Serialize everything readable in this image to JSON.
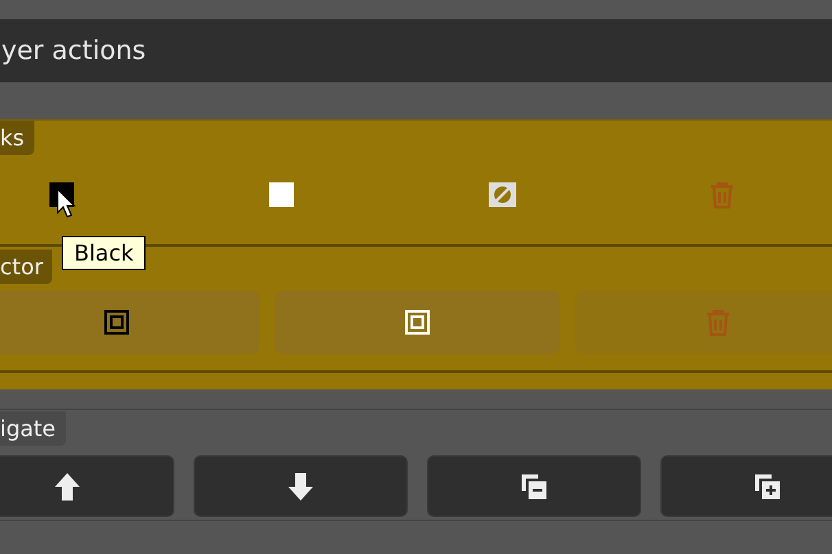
{
  "title": "yer actions",
  "sections": [
    {
      "label": "ks",
      "buttons": [
        {
          "disabled": false
        },
        {
          "disabled": false
        },
        {
          "disabled": false
        },
        {
          "disabled": true
        }
      ]
    },
    {
      "label": "ctor",
      "buttons": [
        {
          "disabled": false
        },
        {
          "disabled": false
        },
        {
          "disabled": true
        }
      ]
    }
  ],
  "tooltip": "Black",
  "navigate": {
    "label": "igate",
    "buttons": [
      {
        "disabled": false
      },
      {
        "disabled": false
      },
      {
        "disabled": false
      },
      {
        "disabled": false
      }
    ]
  }
}
